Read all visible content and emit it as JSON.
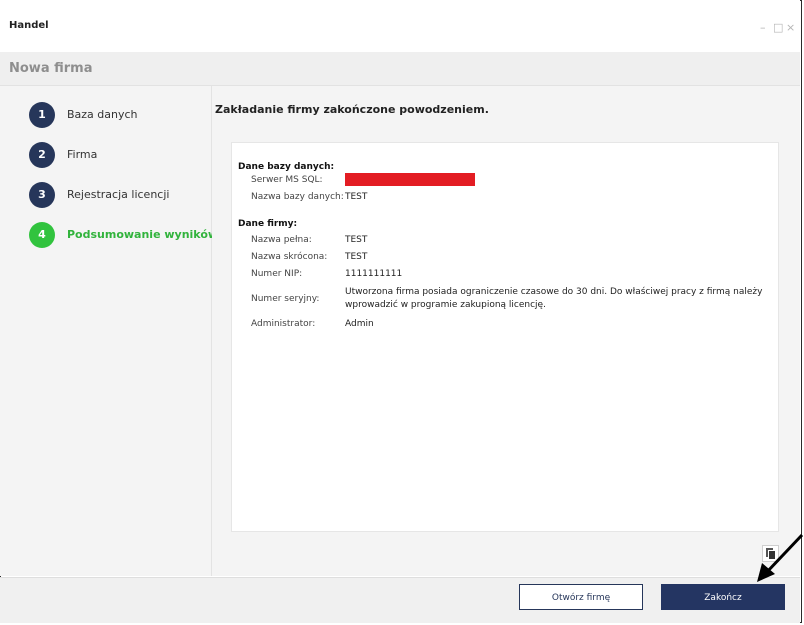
{
  "window": {
    "title": "Handel",
    "controls": {
      "minimize": "–",
      "maximize": "□",
      "close": "×"
    }
  },
  "header": {
    "title": "Nowa firma"
  },
  "steps": [
    {
      "number": "1",
      "label": "Baza danych"
    },
    {
      "number": "2",
      "label": "Firma"
    },
    {
      "number": "3",
      "label": "Rejestracja licencji"
    },
    {
      "number": "4",
      "label": "Podsumowanie wyników",
      "active": true
    }
  ],
  "summary": {
    "heading": "Zakładanie firmy zakończone powodzeniem.",
    "database": {
      "title": "Dane bazy danych:",
      "server_label": "Serwer MS SQL:",
      "db_name_label": "Nazwa bazy danych:",
      "db_name_value": "TEST"
    },
    "company": {
      "title": "Dane firmy:",
      "full_name_label": "Nazwa pełna:",
      "full_name_value": "TEST",
      "short_name_label": "Nazwa skrócona:",
      "short_name_value": "TEST",
      "nip_label": "Numer NIP:",
      "nip_value": "1111111111",
      "serial_label": "Numer seryjny:",
      "serial_value": "Utworzona firma posiada ograniczenie czasowe do 30 dni. Do właściwej pracy z firmą należy wprowadzić w programie zakupioną licencję.",
      "admin_label": "Administrator:",
      "admin_value": "Admin"
    }
  },
  "footer": {
    "open_company_label": "Otwórz firmę",
    "finish_label": "Zakończ"
  },
  "colors": {
    "step_inactive": "#26365a",
    "step_active": "#31c33e",
    "primary_button": "#243562",
    "redaction": "#e31d23"
  }
}
